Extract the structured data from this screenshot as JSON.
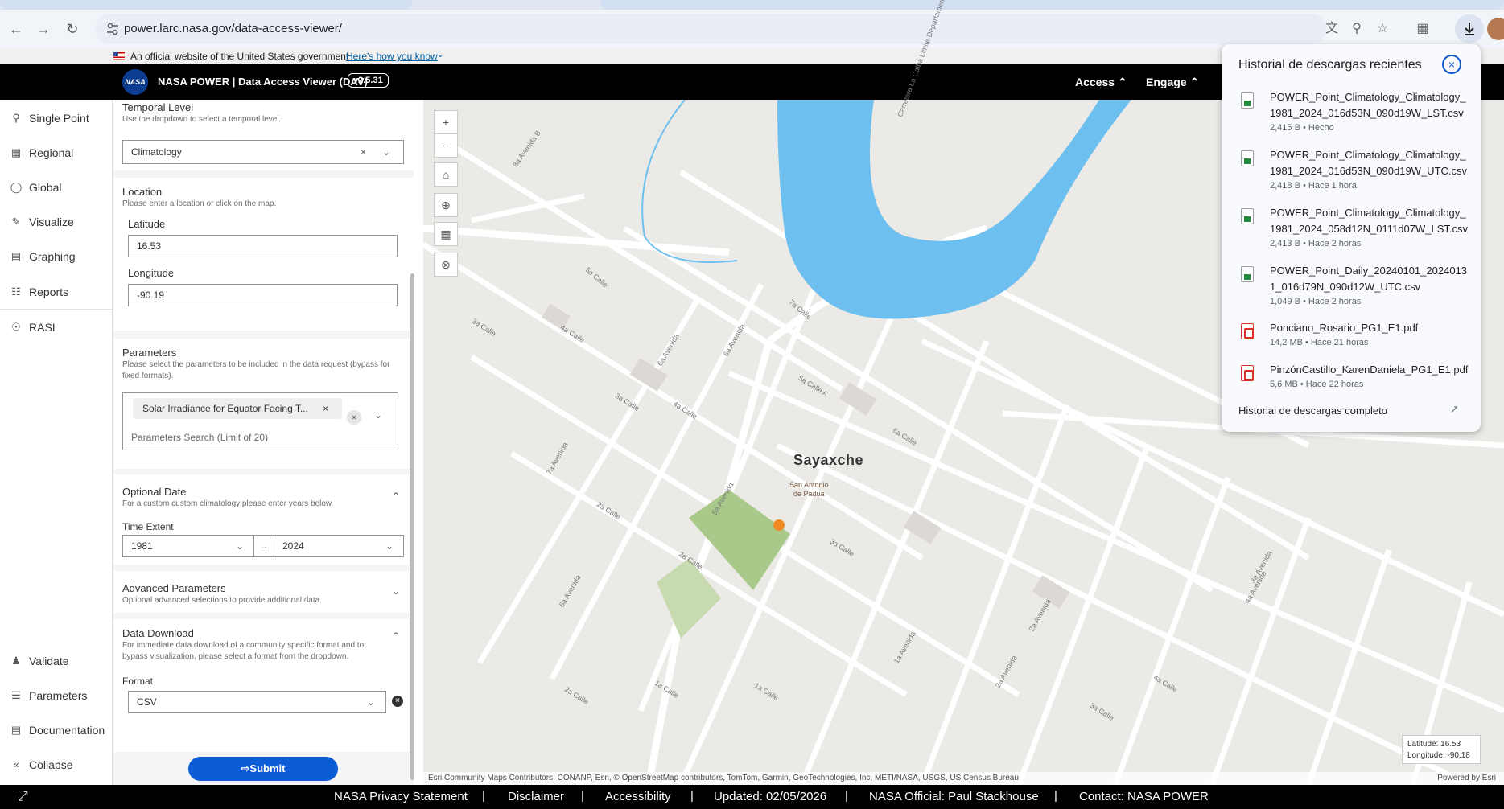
{
  "browser": {
    "url": "power.larc.nasa.gov/data-access-viewer/",
    "icons": [
      "back-icon",
      "forward-icon",
      "reload-icon",
      "site-info-icon",
      "translate-icon",
      "zoom-icon",
      "bookmark-star-icon",
      "extensions-icon",
      "download-icon"
    ]
  },
  "gov_banner": {
    "text": "An official website of the United States government",
    "link": "Here's how you know"
  },
  "header": {
    "logo_text": "NASA",
    "title": "NASA POWER | Data Access Viewer (DAV)",
    "version": "v2.5.31",
    "menus": [
      "Access",
      "Engage"
    ]
  },
  "sidebar": {
    "items": [
      {
        "label": "Single Point",
        "icon": "map-pin-icon"
      },
      {
        "label": "Regional",
        "icon": "region-icon"
      },
      {
        "label": "Global",
        "icon": "globe-icon"
      },
      {
        "label": "Visualize",
        "icon": "visualize-icon"
      },
      {
        "label": "Graphing",
        "icon": "graph-icon"
      },
      {
        "label": "Reports",
        "icon": "reports-icon"
      },
      {
        "label": "RASI",
        "icon": "bulb-icon"
      }
    ],
    "bottom_items": [
      {
        "label": "Validate",
        "icon": "validate-icon"
      },
      {
        "label": "Parameters",
        "icon": "parameters-icon"
      },
      {
        "label": "Documentation",
        "icon": "documentation-icon"
      },
      {
        "label": "Collapse",
        "icon": "collapse-icon"
      }
    ]
  },
  "form": {
    "temporal": {
      "title": "Temporal Level",
      "desc": "Use the dropdown to select a temporal level.",
      "value": "Climatology"
    },
    "location": {
      "title": "Location",
      "desc": "Please enter a location or click on the map.",
      "lat_label": "Latitude",
      "lat_value": "16.53",
      "lon_label": "Longitude",
      "lon_value": "-90.19"
    },
    "parameters": {
      "title": "Parameters",
      "desc": "Please select the parameters to be included in the data request (bypass for fixed formats).",
      "chip": "Solar Irradiance for Equator Facing T...",
      "placeholder": "Parameters Search (Limit of 20)"
    },
    "optional_date": {
      "title": "Optional Date",
      "desc": "For a custom custom climatology please enter years below.",
      "time_label": "Time Extent",
      "start": "1981",
      "arrow": "→",
      "end": "2024"
    },
    "advanced": {
      "title": "Advanced Parameters",
      "desc": "Optional advanced selections to provide additional data."
    },
    "data_download": {
      "title": "Data Download",
      "desc": "For immediate data download of a community specific format and to bypass visualization, please select a format from the dropdown.",
      "format_label": "Format",
      "format_value": "CSV"
    },
    "submit": "Submit"
  },
  "map": {
    "city": "Sayaxche",
    "subcity_line1": "San Antonio",
    "subcity_line2": "de Padua",
    "street_labels": [
      "8a Avenida B",
      "5a Calle",
      "3a Calle",
      "4a Calle",
      "7a Calle",
      "6a Avenida",
      "6a Avenida",
      "3a Calle",
      "4a Calle",
      "7a Avenida",
      "5a Calle A",
      "6a Calle",
      "2a Calle",
      "5a Avenida",
      "3a Calle",
      "2a Calle",
      "6a Avenida",
      "1a Calle",
      "1a Calle",
      "1a Avenida",
      "2a Avenida",
      "2a Calle",
      "3a Calle",
      "4a Calle",
      "3a Avenida",
      "2a Avenida",
      "4a Avenida",
      "Carretera La Calba Limite Departamental"
    ],
    "coords_lat": "Latitude: 16.53",
    "coords_lon": "Longitude: -90.18",
    "attribution": "Esri Community Maps Contributors, CONANP, Esri, © OpenStreetMap contributors, TomTom, Garmin, GeoTechnologies, Inc, METI/NASA, USGS, US Census Bureau",
    "powered": "Powered by Esri",
    "controls": [
      "+",
      "−"
    ],
    "colors": {
      "water": "#6dbfef",
      "park": "#a9c98a",
      "marker": "#f08a24"
    }
  },
  "footer": {
    "items": [
      "NASA Privacy Statement",
      "Disclaimer",
      "Accessibility",
      "Updated: 02/05/2026",
      "NASA Official: Paul Stackhouse",
      "Contact: NASA POWER"
    ]
  },
  "downloads": {
    "title": "Historial de descargas recientes",
    "items": [
      {
        "name": "POWER_Point_Climatology_Climatology_1981_2024_016d53N_090d19W_LST.csv",
        "meta": "2,415 B • Hecho",
        "type": "csv"
      },
      {
        "name": "POWER_Point_Climatology_Climatology_1981_2024_016d53N_090d19W_UTC.csv",
        "meta": "2,418 B • Hace 1 hora",
        "type": "csv"
      },
      {
        "name": "POWER_Point_Climatology_Climatology_1981_2024_058d12N_0111d07W_LST.csv",
        "meta": "2,413 B • Hace 2 horas",
        "type": "csv"
      },
      {
        "name": "POWER_Point_Daily_20240101_20240131_016d79N_090d12W_UTC.csv",
        "meta": "1,049 B • Hace 2 horas",
        "type": "csv"
      },
      {
        "name": "Ponciano_Rosario_PG1_E1.pdf",
        "meta": "14,2 MB • Hace 21 horas",
        "type": "pdf"
      },
      {
        "name": "PinzónCastillo_KarenDaniela_PG1_E1.pdf",
        "meta": "5,6 MB • Hace 22 horas",
        "type": "pdf"
      }
    ],
    "full_history": "Historial de descargas completo"
  }
}
